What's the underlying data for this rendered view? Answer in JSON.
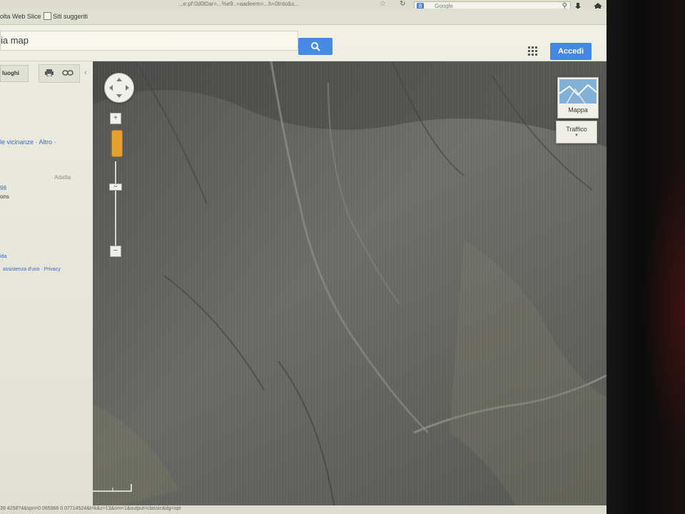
{
  "browser": {
    "url_fragment": "...e:pf:0d0t0ar=...%e9..=aadeem=...h=0tnto&s...",
    "bookmarks": [
      "olta Web Slice",
      "Siti suggeriti"
    ],
    "search_engine_label": "Google",
    "icons": [
      "star-icon",
      "refresh-icon",
      "download-icon",
      "home-icon"
    ]
  },
  "maps_header": {
    "query": "ia map",
    "signin_label": "Accedi",
    "accent": "#3d84e4"
  },
  "left_panel": {
    "tab_label": "luoghi",
    "nearby_link": "le vicinanze · Altro ·",
    "adatta_label": "Adatta",
    "line1": "98",
    "line2": "ons",
    "link_short": "ida",
    "bottom_links": "assistenza d'uso · Privacy"
  },
  "map": {
    "view": "satellite",
    "layer_mappa": "Mappa",
    "layer_traffico": "Traffico",
    "zoom_in": "+",
    "zoom_out": "−",
    "scale_labels": [
      "",
      ""
    ]
  },
  "status_bar": {
    "text": "39 4258?4&spn=0 065966 0 07714524&t=k&z=13&om=1&output=classic&dg=opt"
  }
}
